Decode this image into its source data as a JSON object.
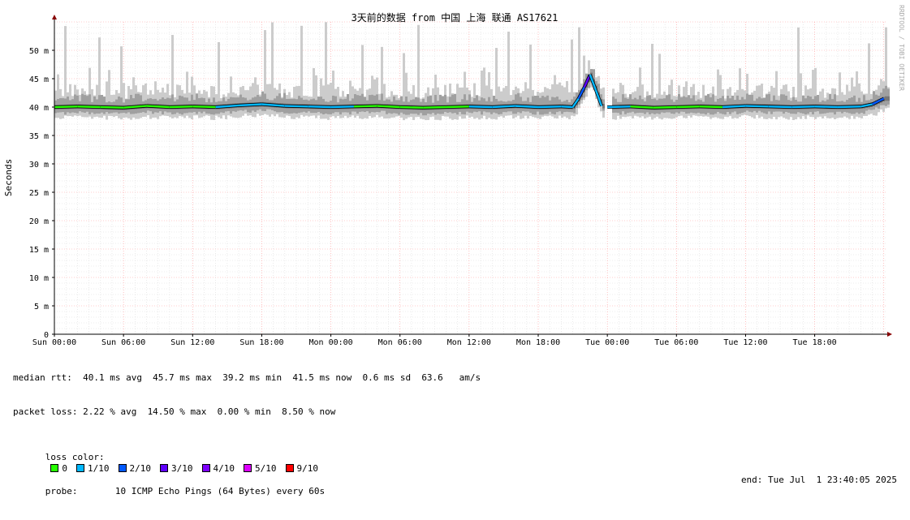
{
  "chart_data": {
    "type": "line",
    "title": "3天前的数据 from 中国 上海 联通 AS17621",
    "ylabel": "Seconds",
    "watermark": "RRDTOOL / TOBI OETIKER",
    "ylim_ms": [
      0,
      55
    ],
    "y_ticks": [
      {
        "value": 0,
        "label": "0"
      },
      {
        "value": 5,
        "label": "5 m"
      },
      {
        "value": 10,
        "label": "10 m"
      },
      {
        "value": 15,
        "label": "15 m"
      },
      {
        "value": 20,
        "label": "20 m"
      },
      {
        "value": 25,
        "label": "25 m"
      },
      {
        "value": 30,
        "label": "30 m"
      },
      {
        "value": 35,
        "label": "35 m"
      },
      {
        "value": 40,
        "label": "40 m"
      },
      {
        "value": 45,
        "label": "45 m"
      },
      {
        "value": 50,
        "label": "50 m"
      }
    ],
    "xlim_hours": [
      0,
      72.3
    ],
    "x_ticks": [
      {
        "hour": 0,
        "label": "Sun 00:00"
      },
      {
        "hour": 6,
        "label": "Sun 06:00"
      },
      {
        "hour": 12,
        "label": "Sun 12:00"
      },
      {
        "hour": 18,
        "label": "Sun 18:00"
      },
      {
        "hour": 24,
        "label": "Mon 00:00"
      },
      {
        "hour": 30,
        "label": "Mon 06:00"
      },
      {
        "hour": 36,
        "label": "Mon 12:00"
      },
      {
        "hour": 42,
        "label": "Mon 18:00"
      },
      {
        "hour": 48,
        "label": "Tue 00:00"
      },
      {
        "hour": 54,
        "label": "Tue 06:00"
      },
      {
        "hour": 60,
        "label": "Tue 12:00"
      },
      {
        "hour": 66,
        "label": "Tue 18:00"
      }
    ],
    "grid": true,
    "median_series": {
      "x_hours": [
        0,
        2,
        4,
        6,
        8,
        10,
        12,
        14,
        16,
        18,
        20,
        22,
        24,
        26,
        28,
        30,
        32,
        34,
        36,
        38,
        40,
        42,
        44,
        45,
        45.5,
        46,
        46.5,
        47,
        47.5,
        48,
        50,
        52,
        54,
        56,
        58,
        60,
        62,
        64,
        66,
        68,
        70,
        71,
        72
      ],
      "rtt_ms": [
        40.0,
        40.1,
        40.0,
        39.9,
        40.2,
        40.0,
        40.1,
        40.0,
        40.3,
        40.5,
        40.2,
        40.1,
        40.0,
        40.1,
        40.2,
        40.0,
        39.9,
        40.0,
        40.1,
        40.0,
        40.2,
        40.0,
        40.1,
        40.0,
        41.5,
        43.5,
        45.7,
        43.0,
        40.2,
        40.0,
        40.1,
        39.9,
        40.0,
        40.1,
        40.0,
        40.2,
        40.1,
        40.0,
        40.1,
        40.0,
        40.1,
        40.5,
        41.5
      ],
      "loss_level": [
        0,
        0,
        0,
        0,
        0,
        0,
        0,
        1,
        1,
        1,
        1,
        1,
        1,
        0,
        0,
        0,
        0,
        0,
        1,
        1,
        1,
        1,
        1,
        1,
        2,
        3,
        1,
        1,
        1,
        1,
        0,
        0,
        0,
        0,
        1,
        1,
        1,
        1,
        1,
        1,
        1,
        2,
        2
      ]
    },
    "smoke_band_ms": {
      "min": 39.2,
      "typical_high": 44,
      "spike_max": 55
    }
  },
  "legend": {
    "rtt_line": "median rtt:  40.1 ms avg  45.7 ms max  39.2 ms min  41.5 ms now  0.6 ms sd  63.6   am/s",
    "loss_line": "packet loss: 2.22 % avg  14.50 % max  0.00 % min  8.50 % now",
    "loss_color_label": "loss color:",
    "loss_colors": [
      {
        "label": "0",
        "color": "#26ff00"
      },
      {
        "label": "1/10",
        "color": "#00b8ff"
      },
      {
        "label": "2/10",
        "color": "#0059ff"
      },
      {
        "label": "3/10",
        "color": "#5e00ff"
      },
      {
        "label": "4/10",
        "color": "#7e00ff"
      },
      {
        "label": "5/10",
        "color": "#dd00ff"
      },
      {
        "label": "9/10",
        "color": "#ff0000"
      }
    ],
    "probe": "probe:       10 ICMP Echo Pings (64 Bytes) every 60s",
    "end": "end: Tue Jul  1 23:40:05 2025"
  },
  "colors": {
    "grid_minor": "#dddddd",
    "grid_major": "#ff9999",
    "smoke_light": "#cccccc",
    "smoke_mid": "#a0a0a0",
    "smoke_dark": "#777777",
    "median_outline": "#000000",
    "axis": "#000000",
    "arrow": "#880000"
  }
}
